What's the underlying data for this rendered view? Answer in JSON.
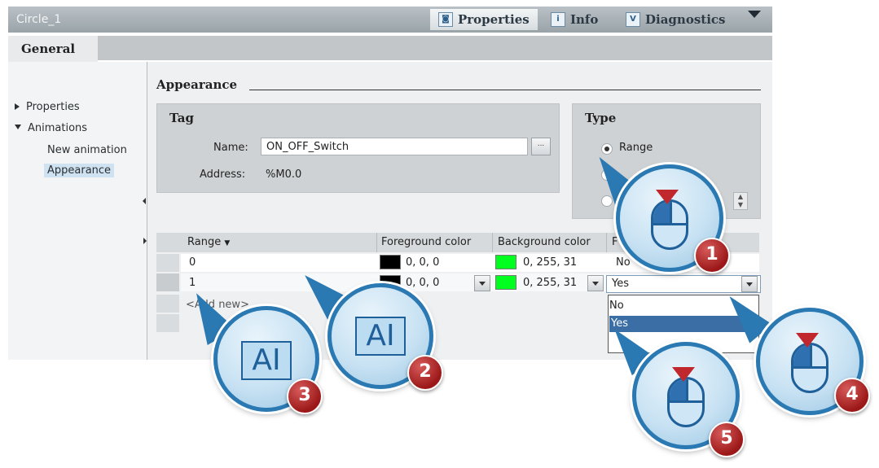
{
  "window": {
    "title": "Circle_1"
  },
  "top_tabs": [
    {
      "label": "Properties",
      "icon": "properties-icon"
    },
    {
      "label": "Info",
      "icon": "info-icon"
    },
    {
      "label": "Diagnostics",
      "icon": "diagnostics-icon"
    }
  ],
  "general_tab": "General",
  "nav": {
    "properties": "Properties",
    "animations": "Animations",
    "new_animation": "New animation",
    "appearance": "Appearance"
  },
  "section": {
    "title": "Appearance"
  },
  "tag": {
    "title": "Tag",
    "name_label": "Name:",
    "name_value": "ON_OFF_Switch",
    "browse_label": "...",
    "address_label": "Address:",
    "address_value": "%M0.0"
  },
  "type": {
    "title": "Type",
    "range_option": "Range"
  },
  "table": {
    "headers": {
      "range": "Range",
      "foreground": "Foreground color",
      "background": "Background color",
      "flashing": "F"
    },
    "rows": [
      {
        "range": "0",
        "fg": "0, 0, 0",
        "bg": "0, 255, 31",
        "flash": "No"
      },
      {
        "range": "1",
        "fg": "0, 0, 0",
        "bg": "0, 255, 31",
        "flash": "Yes"
      }
    ],
    "add_row": "<Add new>",
    "dropdown_options": [
      "No",
      "Yes"
    ],
    "selected_option": "Yes"
  },
  "colors": {
    "fg_swatch": "#000000",
    "bg_swatch": "#00ff1f",
    "highlight": "#3a6ea5",
    "callout_border": "#2a79b3",
    "badge": "#9c1818"
  },
  "callouts": [
    {
      "number": "1",
      "icon": "mouse-click-icon"
    },
    {
      "number": "2",
      "icon": "text-input-icon"
    },
    {
      "number": "3",
      "icon": "text-input-icon"
    },
    {
      "number": "4",
      "icon": "mouse-click-icon"
    },
    {
      "number": "5",
      "icon": "mouse-click-icon"
    }
  ]
}
